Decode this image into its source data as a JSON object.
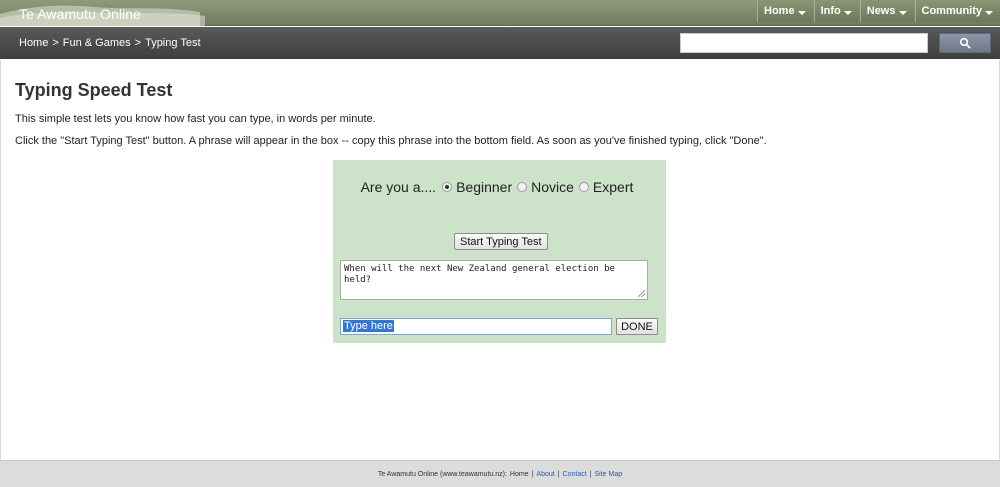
{
  "header": {
    "site_title": "Te Awamutu Online",
    "nav": [
      {
        "label": "Home"
      },
      {
        "label": "Info"
      },
      {
        "label": "News"
      },
      {
        "label": "Community"
      }
    ]
  },
  "breadcrumb": {
    "items": [
      "Home",
      "Fun & Games",
      "Typing Test"
    ],
    "separator": ">"
  },
  "search": {
    "value": "",
    "button_icon": "search-icon"
  },
  "page": {
    "title": "Typing Speed Test",
    "intro": "This simple test lets you know how fast you can type, in words per minute.",
    "instructions": "Click the \"Start Typing Test\" button. A phrase will appear in the box -- copy this phrase into the bottom field. As soon as you've finished typing, click \"Done\"."
  },
  "test": {
    "question": "Are you a....",
    "levels": [
      {
        "label": "Beginner",
        "selected": true
      },
      {
        "label": "Novice",
        "selected": false
      },
      {
        "label": "Expert",
        "selected": false
      }
    ],
    "start_label": "Start Typing Test",
    "phrase": "When will the next New Zealand general election be held?",
    "type_value": "Type here",
    "done_label": "DONE"
  },
  "footer": {
    "text": "Te Awamutu Online (www.teawamutu.nz):",
    "links": [
      "Home",
      "About",
      "Contact",
      "Site Map"
    ]
  },
  "colors": {
    "topbar": "#7f8a6b",
    "crumbbar": "#4a4a4a",
    "test_box": "#cce3c9",
    "footer": "#dcdcdc",
    "link": "#2a5db0"
  }
}
